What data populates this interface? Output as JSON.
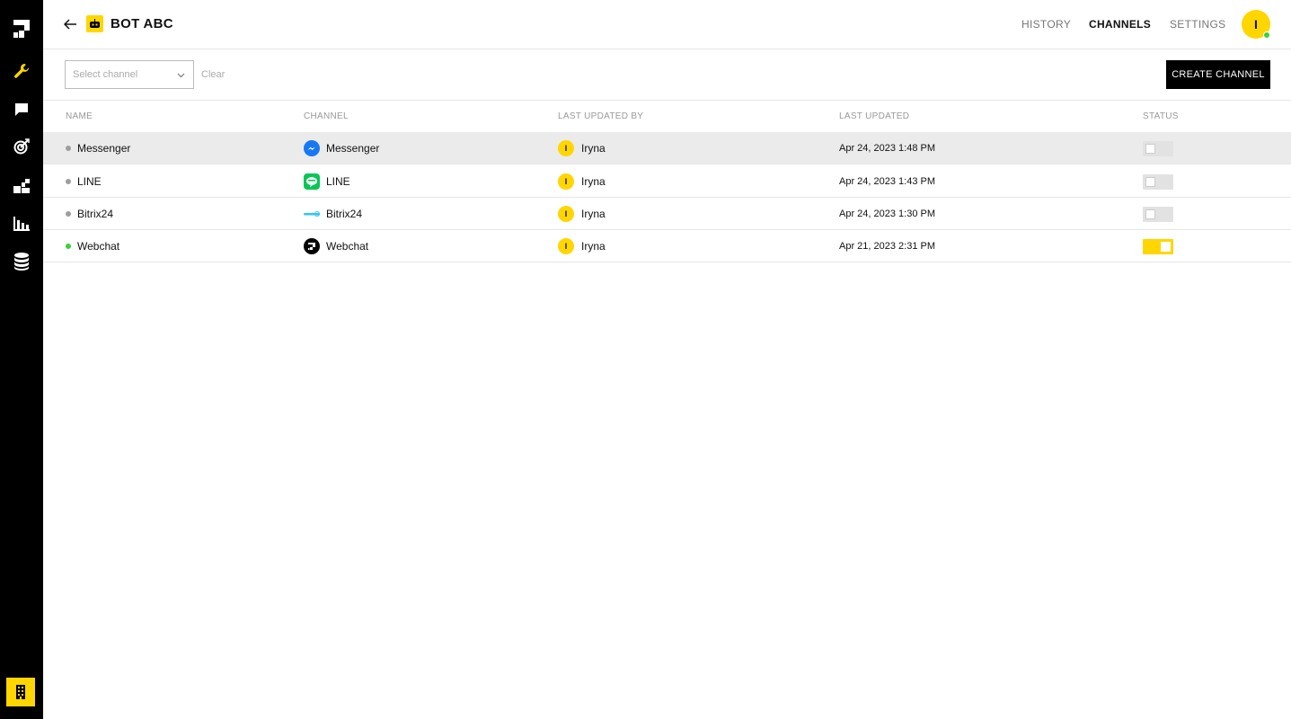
{
  "sidebar": {
    "items": [
      {
        "icon": "logo-icon"
      },
      {
        "icon": "wrench-icon",
        "active": true
      },
      {
        "icon": "chat-icon"
      },
      {
        "icon": "target-icon"
      },
      {
        "icon": "blocks-icon"
      },
      {
        "icon": "analytics-icon"
      },
      {
        "icon": "database-icon"
      }
    ],
    "bottom_icon": "building-icon"
  },
  "header": {
    "title": "BOT ABC",
    "nav": [
      "HISTORY",
      "CHANNELS",
      "SETTINGS"
    ],
    "active_nav": "CHANNELS",
    "avatar_initial": "I"
  },
  "toolbar": {
    "select_placeholder": "Select channel",
    "clear_label": "Clear",
    "create_label": "CREATE CHANNEL"
  },
  "table": {
    "columns": [
      "NAME",
      "CHANNEL",
      "LAST UPDATED BY",
      "LAST UPDATED",
      "STATUS"
    ],
    "rows": [
      {
        "name": "Messenger",
        "channel": "Messenger",
        "channel_icon": "messenger-icon",
        "user_initial": "I",
        "user": "Iryna",
        "updated": "Apr 24, 2023 1:48 PM",
        "enabled": false
      },
      {
        "name": "LINE",
        "channel": "LINE",
        "channel_icon": "line-icon",
        "user_initial": "I",
        "user": "Iryna",
        "updated": "Apr 24, 2023 1:43 PM",
        "enabled": false
      },
      {
        "name": "Bitrix24",
        "channel": "Bitrix24",
        "channel_icon": "bitrix24-icon",
        "user_initial": "I",
        "user": "Iryna",
        "updated": "Apr 24, 2023 1:30 PM",
        "enabled": false
      },
      {
        "name": "Webchat",
        "channel": "Webchat",
        "channel_icon": "webchat-icon",
        "user_initial": "I",
        "user": "Iryna",
        "updated": "Apr 21, 2023 2:31 PM",
        "enabled": true
      }
    ]
  },
  "colors": {
    "accent": "#ffd600",
    "active_status": "#3ad13a",
    "inactive_status": "#9e9e9e"
  }
}
